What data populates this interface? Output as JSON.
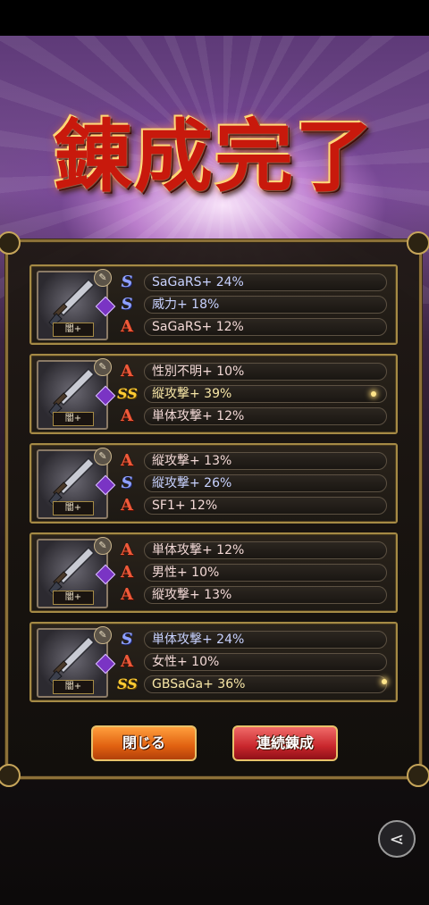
{
  "title": "錬成完了",
  "cards": [
    {
      "level_badge": "闇+",
      "lines": [
        {
          "icon": "S",
          "type": "S",
          "text": "SaGaRS+ 24%",
          "tone": "blue"
        },
        {
          "icon": "S",
          "type": "S",
          "text": "威力+ 18%",
          "tone": "blue"
        },
        {
          "icon": "A",
          "type": "A",
          "text": "SaGaRS+ 12%",
          "tone": "pink"
        }
      ]
    },
    {
      "level_badge": "闇+",
      "lines": [
        {
          "icon": "A",
          "type": "A",
          "text": "性別不明+ 10%",
          "tone": "pink"
        },
        {
          "icon": "SS",
          "type": "SS",
          "text": "縦攻撃+ 39%",
          "tone": "gold"
        },
        {
          "icon": "A",
          "type": "A",
          "text": "単体攻撃+ 12%",
          "tone": "pink"
        }
      ]
    },
    {
      "level_badge": "闇+",
      "lines": [
        {
          "icon": "A",
          "type": "A",
          "text": "縦攻撃+ 13%",
          "tone": "pink"
        },
        {
          "icon": "S",
          "type": "S",
          "text": "縦攻撃+ 26%",
          "tone": "blue"
        },
        {
          "icon": "A",
          "type": "A",
          "text": "SF1+ 12%",
          "tone": "pink"
        }
      ]
    },
    {
      "level_badge": "闇+",
      "lines": [
        {
          "icon": "A",
          "type": "A",
          "text": "単体攻撃+ 12%",
          "tone": "pink"
        },
        {
          "icon": "A",
          "type": "A",
          "text": "男性+ 10%",
          "tone": "pink"
        },
        {
          "icon": "A",
          "type": "A",
          "text": "縦攻撃+ 13%",
          "tone": "pink"
        }
      ]
    },
    {
      "level_badge": "闇+",
      "lines": [
        {
          "icon": "S",
          "type": "S",
          "text": "単体攻撃+ 24%",
          "tone": "blue"
        },
        {
          "icon": "A",
          "type": "A",
          "text": "女性+ 10%",
          "tone": "pink"
        },
        {
          "icon": "SS",
          "type": "SS",
          "text": "GBSaGa+ 36%",
          "tone": "gold"
        }
      ]
    }
  ],
  "buttons": {
    "close_label": "閉じる",
    "continue_label": "連続錬成"
  },
  "icons": {
    "weapon": "sword-icon",
    "share": "share-icon"
  },
  "colors": {
    "rank_A": "#ef5a3a",
    "rank_S": "#8ea0ff",
    "rank_SS": "#ffcc33",
    "close_button": "#e06010",
    "continue_button": "#c8262c"
  }
}
